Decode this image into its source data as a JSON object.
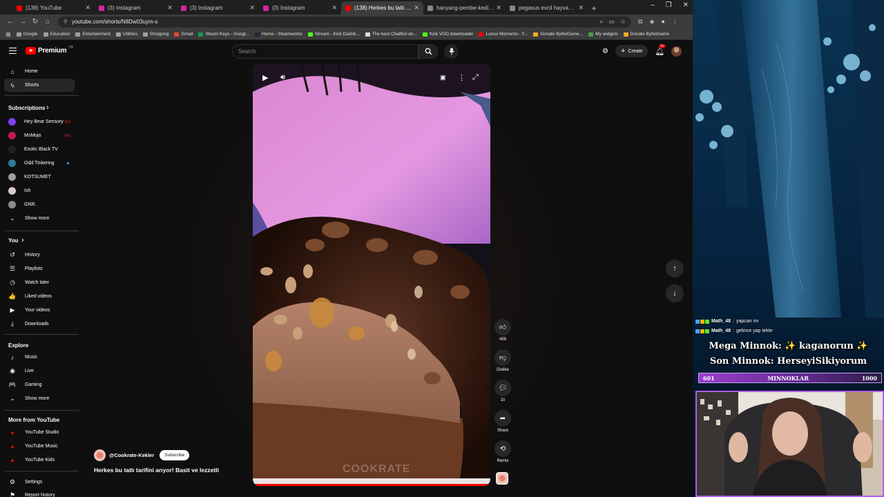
{
  "browser": {
    "tabs": [
      {
        "title": "(138) YouTube",
        "color": "#ff0000",
        "active": false
      },
      {
        "title": "(3) Instagram",
        "color": "#d6249f",
        "active": false
      },
      {
        "title": "(3) Instagram",
        "color": "#d6249f",
        "active": false
      },
      {
        "title": "(3) Instagram",
        "color": "#d6249f",
        "active": false
      },
      {
        "title": "(138) Herkes bu tatlı tarifini arı",
        "color": "#ff0000",
        "active": true
      },
      {
        "title": "hanyang-pembe-kedi-tasima-c",
        "color": "#888888",
        "active": false
      },
      {
        "title": "pegasus evcil hayvan kilo sınır",
        "color": "#888888",
        "active": false
      }
    ],
    "new_tab": "+",
    "url": "youtube.com/shorts/N8Dw03uym-s",
    "window_controls": [
      "–",
      "❐",
      "✕"
    ],
    "bookmarks": [
      {
        "label": "Google",
        "color": "#9aa0a6"
      },
      {
        "label": "Education",
        "color": "#9aa0a6"
      },
      {
        "label": "Entertainment",
        "color": "#9aa0a6"
      },
      {
        "label": "Utilities",
        "color": "#9aa0a6"
      },
      {
        "label": "Shopping",
        "color": "#9aa0a6"
      },
      {
        "label": "Gmail",
        "color": "#ea4335"
      },
      {
        "label": "Steam Keys - Googl...",
        "color": "#0f9d58"
      },
      {
        "label": "Home - Steamworks",
        "color": "#1b2838"
      },
      {
        "label": "Stream - Kick Dashb...",
        "color": "#53fc18"
      },
      {
        "label": "The best ChatBot an...",
        "color": "#dddddd"
      },
      {
        "label": "Kick VOD downloader",
        "color": "#53fc18"
      },
      {
        "label": "Lunox Moments - Y...",
        "color": "#ff0000"
      },
      {
        "label": "Donate ByNoGame...",
        "color": "#f9a825"
      },
      {
        "label": "My widgets",
        "color": "#43a047"
      },
      {
        "label": "Donate ByNoGame",
        "color": "#f9a825"
      }
    ]
  },
  "youtube": {
    "logo": "Premium",
    "logo_country": "TR",
    "search_placeholder": "Search",
    "create_label": "Create",
    "notifications": "9+",
    "sidebar": {
      "main": [
        {
          "label": "Home",
          "icon": "home-icon",
          "glyph": "⌂"
        },
        {
          "label": "Shorts",
          "icon": "shorts-icon",
          "glyph": "ϟ",
          "active": true
        }
      ],
      "subscriptions_header": "Subscriptions",
      "subscriptions": [
        {
          "label": "Hey Bear Sensory",
          "color": "#7b3ff2",
          "status": "live"
        },
        {
          "label": "MsMojo",
          "color": "#c2185b",
          "status": "live"
        },
        {
          "label": "Exotic Black TV",
          "color": "#222222",
          "status": ""
        },
        {
          "label": "Odd Tinkering",
          "color": "#2e7d9b",
          "status": "new"
        },
        {
          "label": "KOTSUMET",
          "color": "#9e9e9e",
          "status": ""
        },
        {
          "label": "Ish",
          "color": "#d7ccc8",
          "status": ""
        },
        {
          "label": "GNR.",
          "color": "#8d8d8d",
          "status": ""
        }
      ],
      "show_more": "Show more",
      "you_header": "You",
      "you": [
        {
          "label": "History",
          "icon": "history-icon",
          "glyph": "↺"
        },
        {
          "label": "Playlists",
          "icon": "playlists-icon",
          "glyph": "☰"
        },
        {
          "label": "Watch later",
          "icon": "watch-later-icon",
          "glyph": "◷"
        },
        {
          "label": "Liked videos",
          "icon": "like-icon",
          "glyph": "👍"
        },
        {
          "label": "Your videos",
          "icon": "your-videos-icon",
          "glyph": "▶"
        },
        {
          "label": "Downloads",
          "icon": "download-icon",
          "glyph": "⤓"
        }
      ],
      "explore_header": "Explore",
      "explore": [
        {
          "label": "Music",
          "icon": "music-icon",
          "glyph": "♪"
        },
        {
          "label": "Live",
          "icon": "live-icon",
          "glyph": "◉"
        },
        {
          "label": "Gaming",
          "icon": "gaming-icon",
          "glyph": "🎮"
        }
      ],
      "explore_show_more": "Show more",
      "more_header": "More from YouTube",
      "more": [
        {
          "label": "YouTube Studio"
        },
        {
          "label": "YouTube Music"
        },
        {
          "label": "YouTube Kids"
        }
      ],
      "settings": "Settings",
      "report": "Report history"
    },
    "short": {
      "channel": "@Cookrate-Kekler",
      "subscribe": "Subscribe",
      "title": "Herkes bu tatlı tarifini arıyor! Basit ve lezzetli",
      "watermark": "COOKRATE",
      "progress": 0.99,
      "actions": {
        "likes": "459",
        "dislike": "Dislike",
        "comments": "10",
        "share": "Share",
        "remix": "Remix"
      }
    }
  },
  "stream_overlay": {
    "chat": [
      {
        "user": "Math_48",
        "message": "yapcan mı"
      },
      {
        "user": "Math_48",
        "message": "gelince yap tekte"
      }
    ],
    "mega_minnok": "Mega Minnok: ✨ kaganorun ✨",
    "son_minnok": "Son Minnok: HerseyiSikiyorum",
    "goal": {
      "current": "601",
      "label": "MINNOKLAR",
      "target": "1000",
      "fraction": 0.6
    }
  }
}
